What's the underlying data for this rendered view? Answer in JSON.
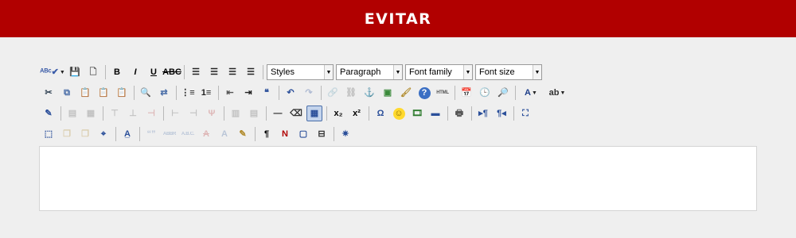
{
  "header": {
    "title": "EVITAR",
    "color": "#b10000"
  },
  "toolbar": {
    "rows": [
      [
        {
          "name": "spellcheck-icon",
          "glyph": "ᴬᴮᶜ✔",
          "dropdown": true,
          "wide": true,
          "color": "#3a5ba8"
        },
        {
          "name": "save-icon",
          "glyph": "💾",
          "color": "#2b4f9a"
        },
        {
          "name": "new-document-icon",
          "glyph": "🗋",
          "color": "#555"
        },
        {
          "sep": true
        },
        {
          "name": "bold-icon",
          "glyph": "B",
          "color": "#000"
        },
        {
          "name": "italic-icon",
          "glyph": "I",
          "color": "#000",
          "italic": true
        },
        {
          "name": "underline-icon",
          "glyph": "U",
          "color": "#000",
          "underline": true
        },
        {
          "name": "strikethrough-icon",
          "glyph": "ABC",
          "color": "#000",
          "strike": true
        },
        {
          "sep": true
        },
        {
          "name": "align-left-icon",
          "glyph": "☰",
          "color": "#222"
        },
        {
          "name": "align-center-icon",
          "glyph": "☰",
          "color": "#222"
        },
        {
          "name": "align-right-icon",
          "glyph": "☰",
          "color": "#222"
        },
        {
          "name": "align-justify-icon",
          "glyph": "☰",
          "color": "#222"
        },
        {
          "sep": true
        },
        {
          "name": "styles-select",
          "select": true,
          "label": "Styles",
          "width": 84
        },
        {
          "name": "format-select",
          "select": true,
          "label": "Paragraph",
          "width": 84
        },
        {
          "name": "font-family-select",
          "select": true,
          "label": "Font family",
          "width": 85
        },
        {
          "name": "font-size-select",
          "select": true,
          "label": "Font size",
          "width": 84
        }
      ],
      [
        {
          "name": "cut-icon",
          "glyph": "✂",
          "color": "#345"
        },
        {
          "name": "copy-icon",
          "glyph": "⧉",
          "color": "#4a6ea8"
        },
        {
          "name": "paste-icon",
          "glyph": "📋",
          "color": "#8a6d2a"
        },
        {
          "name": "paste-text-icon",
          "glyph": "📋",
          "color": "#8a6d2a"
        },
        {
          "name": "paste-word-icon",
          "glyph": "📋",
          "color": "#2b4f9a"
        },
        {
          "sep": true
        },
        {
          "name": "find-icon",
          "glyph": "🔍",
          "color": "#333"
        },
        {
          "name": "replace-icon",
          "glyph": "⇄",
          "color": "#4a6ea8"
        },
        {
          "sep": true
        },
        {
          "name": "bullet-list-icon",
          "glyph": "⋮≡",
          "color": "#222"
        },
        {
          "name": "numbered-list-icon",
          "glyph": "1≡",
          "color": "#222"
        },
        {
          "sep": true
        },
        {
          "name": "outdent-icon",
          "glyph": "⇤",
          "color": "#555"
        },
        {
          "name": "indent-icon",
          "glyph": "⇥",
          "color": "#222"
        },
        {
          "name": "blockquote-icon",
          "glyph": "❝",
          "color": "#2b4f9a"
        },
        {
          "sep": true
        },
        {
          "name": "undo-icon",
          "glyph": "↶",
          "color": "#2b4f9a"
        },
        {
          "name": "redo-icon",
          "glyph": "↷",
          "color": "#2b4f9a",
          "disabled": true
        },
        {
          "sep": true
        },
        {
          "name": "link-icon",
          "glyph": "🔗",
          "color": "#666",
          "disabled": true
        },
        {
          "name": "unlink-icon",
          "glyph": "⛓",
          "color": "#666",
          "disabled": true
        },
        {
          "name": "anchor-icon",
          "glyph": "⚓",
          "color": "#2b4f9a"
        },
        {
          "name": "image-icon",
          "glyph": "▣",
          "color": "#3b8a3b"
        },
        {
          "name": "cleanup-icon",
          "glyph": "🖌",
          "color": "#b08a2a"
        },
        {
          "name": "help-icon",
          "glyph": "?",
          "color": "#ffffff",
          "bg": "#3b6fc4",
          "round": true
        },
        {
          "name": "html-source-icon",
          "glyph": "HTML",
          "color": "#555",
          "small": true
        },
        {
          "sep": true
        },
        {
          "name": "insert-date-icon",
          "glyph": "📅",
          "color": "#2b4f9a"
        },
        {
          "name": "insert-time-icon",
          "glyph": "🕒",
          "color": "#2b4f9a"
        },
        {
          "name": "preview-icon",
          "glyph": "🔎",
          "color": "#4a6ea8"
        },
        {
          "sep": true
        },
        {
          "name": "text-color-icon",
          "glyph": "A",
          "color": "#1f3f8a",
          "dropdown": true,
          "wide": true
        },
        {
          "name": "highlight-color-icon",
          "glyph": "ab",
          "color": "#333",
          "dropdown": true,
          "wide": true
        }
      ],
      [
        {
          "name": "edit-css-icon",
          "glyph": "✎",
          "color": "#2b4f9a"
        },
        {
          "sep": true
        },
        {
          "name": "table-row-props-icon",
          "glyph": "▤",
          "color": "#666",
          "disabled": true
        },
        {
          "name": "table-cell-props-icon",
          "glyph": "▦",
          "color": "#666",
          "disabled": true
        },
        {
          "sep": true
        },
        {
          "name": "insert-row-before-icon",
          "glyph": "⊤",
          "color": "#666",
          "disabled": true
        },
        {
          "name": "insert-row-after-icon",
          "glyph": "⊥",
          "color": "#666",
          "disabled": true
        },
        {
          "name": "delete-row-icon",
          "glyph": "⊣",
          "color": "#b44",
          "disabled": true
        },
        {
          "sep": true
        },
        {
          "name": "insert-col-before-icon",
          "glyph": "⊢",
          "color": "#666",
          "disabled": true
        },
        {
          "name": "insert-col-after-icon",
          "glyph": "⊣",
          "color": "#666",
          "disabled": true
        },
        {
          "name": "delete-col-icon",
          "glyph": "Ψ",
          "color": "#b44",
          "disabled": true
        },
        {
          "sep": true
        },
        {
          "name": "split-cells-icon",
          "glyph": "▥",
          "color": "#666",
          "disabled": true
        },
        {
          "name": "merge-cells-icon",
          "glyph": "▤",
          "color": "#666",
          "disabled": true
        },
        {
          "sep": true
        },
        {
          "name": "horizontal-rule-icon",
          "glyph": "—",
          "color": "#222"
        },
        {
          "name": "remove-format-icon",
          "glyph": "⌫",
          "color": "#333"
        },
        {
          "name": "visual-aid-icon",
          "glyph": "▦",
          "color": "#2b4f9a",
          "active": true
        },
        {
          "sep": true
        },
        {
          "name": "subscript-icon",
          "glyph": "x₂",
          "color": "#000"
        },
        {
          "name": "superscript-icon",
          "glyph": "x²",
          "color": "#000"
        },
        {
          "sep": true
        },
        {
          "name": "special-char-icon",
          "glyph": "Ω",
          "color": "#2b4f9a"
        },
        {
          "name": "emoticon-icon",
          "glyph": "☺",
          "color": "#8a6d00",
          "bg": "#ffd92e",
          "round": true
        },
        {
          "name": "media-icon",
          "glyph": "🎞",
          "color": "#2c7a2c"
        },
        {
          "name": "advanced-hr-icon",
          "glyph": "▬",
          "color": "#2b4f9a"
        },
        {
          "sep": true
        },
        {
          "name": "print-icon",
          "glyph": "🖶",
          "color": "#555"
        },
        {
          "sep": true
        },
        {
          "name": "ltr-icon",
          "glyph": "▸¶",
          "color": "#2b4f9a"
        },
        {
          "name": "rtl-icon",
          "glyph": "¶◂",
          "color": "#2b4f9a"
        },
        {
          "sep": true
        },
        {
          "name": "fullscreen-icon",
          "glyph": "⛶",
          "color": "#2b4f9a"
        }
      ],
      [
        {
          "name": "insert-layer-icon",
          "glyph": "⬚",
          "color": "#2b4f9a"
        },
        {
          "name": "move-forward-icon",
          "glyph": "❐",
          "color": "#b08a2a",
          "disabled": true
        },
        {
          "name": "move-backward-icon",
          "glyph": "❐",
          "color": "#b08a2a",
          "disabled": true
        },
        {
          "name": "absolute-position-icon",
          "glyph": "⌖",
          "color": "#2b4f9a"
        },
        {
          "sep": true
        },
        {
          "name": "styleprops-icon",
          "glyph": "A̲",
          "color": "#2b4f9a"
        },
        {
          "sep": true
        },
        {
          "name": "cite-icon",
          "glyph": "“”",
          "color": "#4a6ea8",
          "disabled": true
        },
        {
          "name": "abbr-icon",
          "glyph": "ABBR",
          "color": "#4a6ea8",
          "disabled": true,
          "small": true
        },
        {
          "name": "acronym-icon",
          "glyph": "A.B.C.",
          "color": "#4a6ea8",
          "disabled": true,
          "small": true
        },
        {
          "name": "delete-text-icon",
          "glyph": "A",
          "color": "#b44",
          "disabled": true,
          "strike": true
        },
        {
          "name": "insert-text-icon",
          "glyph": "A",
          "color": "#4a6ea8",
          "disabled": true
        },
        {
          "name": "attribs-icon",
          "glyph": "✎",
          "color": "#b08a2a"
        },
        {
          "sep": true
        },
        {
          "name": "visual-chars-icon",
          "glyph": "¶",
          "color": "#000"
        },
        {
          "name": "non-breaking-icon",
          "glyph": "N",
          "color": "#b00000"
        },
        {
          "name": "template-icon",
          "glyph": "▢",
          "color": "#2b4f9a"
        },
        {
          "name": "page-break-icon",
          "glyph": "⊟",
          "color": "#333"
        },
        {
          "sep": true
        },
        {
          "name": "block-icon",
          "glyph": "✷",
          "color": "#2b4f9a"
        }
      ]
    ]
  }
}
